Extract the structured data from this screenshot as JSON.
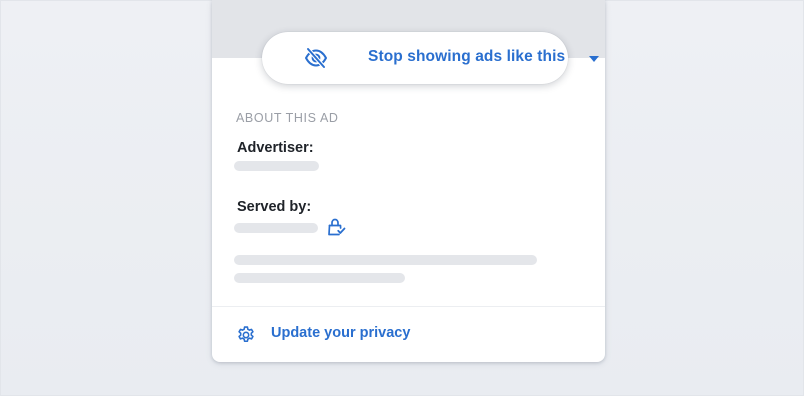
{
  "menu": {
    "stop_ads_label": "Stop showing ads like this",
    "stop_ads_icon": "eye-slash-icon",
    "dropdown_icon": "caret-down-icon"
  },
  "about": {
    "section_title": "ABOUT THIS AD",
    "advertiser_label": "Advertiser:",
    "served_by_label": "Served by:",
    "served_by_icon": "shopping-bag-check-icon"
  },
  "footer": {
    "privacy_label": "Update your privacy",
    "privacy_icon": "gear-icon"
  },
  "colors": {
    "accent": "#2a6fcf",
    "placeholder": "#e4e6ea",
    "background": "#eef0f4",
    "card_header": "#e2e4e8"
  }
}
